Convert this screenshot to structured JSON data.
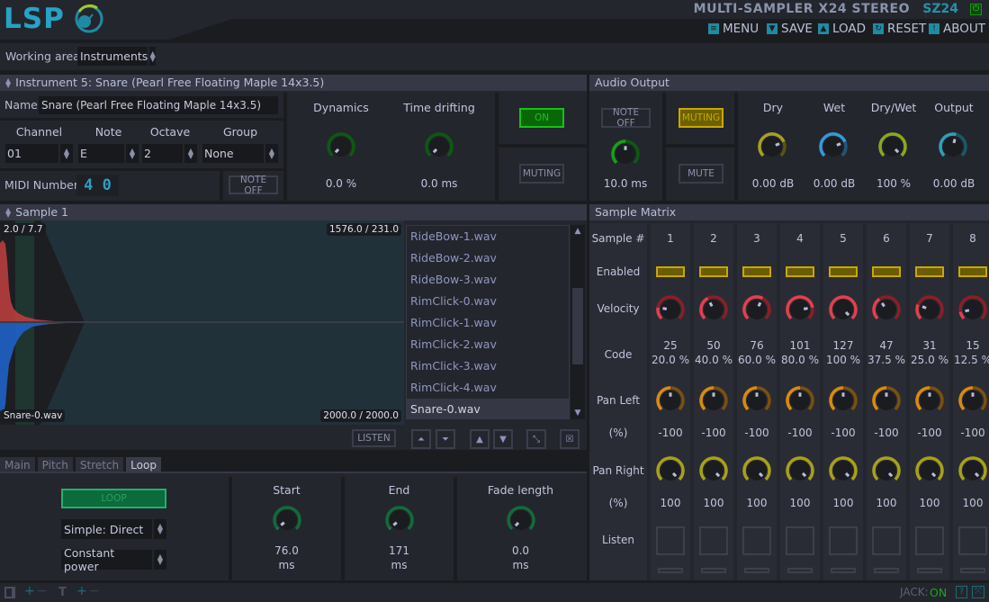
{
  "header": {
    "logo": "LSP",
    "plugin_title": "MULTI-SAMPLER X24 STEREO",
    "plugin_id": "SZ24",
    "menu": [
      {
        "label": "MENU",
        "icon": "menu-icon"
      },
      {
        "label": "SAVE",
        "icon": "save-icon"
      },
      {
        "label": "LOAD",
        "icon": "load-icon"
      },
      {
        "label": "RESET",
        "icon": "reset-icon"
      },
      {
        "label": "ABOUT",
        "icon": "about-icon"
      }
    ]
  },
  "working_area": {
    "label": "Working area",
    "value": "Instruments"
  },
  "instrument": {
    "title": "Instrument 5: Snare (Pearl Free Floating Maple 14x3.5)",
    "name_label": "Name",
    "name_value": "Snare (Pearl Free Floating Maple 14x3.5)",
    "fields": [
      {
        "label": "Channel",
        "value": "01"
      },
      {
        "label": "Note",
        "value": "E"
      },
      {
        "label": "Octave",
        "value": "2"
      },
      {
        "label": "Group",
        "value": "None"
      }
    ],
    "midi_label": "MIDI Number",
    "midi_value": "4 0",
    "note_off_label": "NOTE OFF",
    "dynamics": {
      "label": "Dynamics",
      "value": "0.0 %",
      "fraction": 0.0
    },
    "time_drifting": {
      "label": "Time drifting",
      "value": "0.0 ms",
      "fraction": 0.0
    },
    "on_label": "ON",
    "muting_label": "MUTING"
  },
  "audio_output": {
    "title": "Audio Output",
    "note_off_label": "NOTE OFF",
    "note_off_time": {
      "value": "10.0 ms",
      "fraction": 0.5
    },
    "muting_label": "MUTING",
    "mute_label": "MUTE",
    "knobs": [
      {
        "label": "Dry",
        "value": "0.00 dB",
        "fraction": 0.75,
        "color": "#a8a020"
      },
      {
        "label": "Wet",
        "value": "0.00 dB",
        "fraction": 0.75,
        "color": "#3898d8"
      },
      {
        "label": "Dry/Wet",
        "value": "100 %",
        "fraction": 1.0,
        "color": "#88a820"
      },
      {
        "label": "Output",
        "value": "0.00 dB",
        "fraction": 0.55,
        "color": "#30a0b8"
      }
    ]
  },
  "sample": {
    "title": "Sample 1",
    "top_left": "2.0 / 7.7",
    "top_right": "1576.0 / 231.0",
    "bottom_left": "Snare-0.wav",
    "bottom_right": "2000.0 / 2000.0",
    "listen_label": "LISTEN",
    "files": [
      "RideBow-1.wav",
      "RideBow-2.wav",
      "RideBow-3.wav",
      "RimClick-0.wav",
      "RimClick-1.wav",
      "RimClick-2.wav",
      "RimClick-3.wav",
      "RimClick-4.wav",
      "Snare-0.wav"
    ],
    "selected_file": "Snare-0.wav"
  },
  "tabs": [
    "Main",
    "Pitch",
    "Stretch",
    "Loop"
  ],
  "active_tab": "Loop",
  "loop": {
    "loop_label": "LOOP",
    "mode": "Simple: Direct",
    "crossfade": "Constant power",
    "knobs": [
      {
        "label": "Start",
        "value": "76.0",
        "unit": "ms",
        "fraction": 0.02
      },
      {
        "label": "End",
        "value": "171",
        "unit": "ms",
        "fraction": 0.02
      },
      {
        "label": "Fade length",
        "value": "0.0",
        "unit": "ms",
        "fraction": 0.0
      }
    ]
  },
  "matrix": {
    "title": "Sample Matrix",
    "row_labels": {
      "sample": "Sample #",
      "enabled": "Enabled",
      "velocity": "Velocity",
      "code": "Code",
      "pan_left": "Pan Left",
      "pan_left_unit": "(%)",
      "pan_right": "Pan Right",
      "pan_right_unit": "(%)",
      "listen": "Listen"
    },
    "columns": [
      {
        "n": "1",
        "code": "25",
        "pct": "20.0 %",
        "vel": 0.2,
        "pl": "-100",
        "pr": "100"
      },
      {
        "n": "2",
        "code": "50",
        "pct": "40.0 %",
        "vel": 0.4,
        "pl": "-100",
        "pr": "100"
      },
      {
        "n": "3",
        "code": "76",
        "pct": "60.0 %",
        "vel": 0.6,
        "pl": "-100",
        "pr": "100"
      },
      {
        "n": "4",
        "code": "101",
        "pct": "80.0 %",
        "vel": 0.8,
        "pl": "-100",
        "pr": "100"
      },
      {
        "n": "5",
        "code": "127",
        "pct": "100 %",
        "vel": 1.0,
        "pl": "-100",
        "pr": "100"
      },
      {
        "n": "6",
        "code": "47",
        "pct": "37.5 %",
        "vel": 0.375,
        "pl": "-100",
        "pr": "100"
      },
      {
        "n": "7",
        "code": "31",
        "pct": "25.0 %",
        "vel": 0.25,
        "pl": "-100",
        "pr": "100"
      },
      {
        "n": "8",
        "code": "15",
        "pct": "12.5 %",
        "vel": 0.125,
        "pl": "-100",
        "pr": "100"
      }
    ]
  },
  "status": {
    "jack_label": "JACK:",
    "jack_value": "ON"
  },
  "colors": {
    "accent": "#26a3c4",
    "on_green": "#1eb41e",
    "muting_yellow": "#c8b000",
    "velocity_red": "#e04050",
    "pan_left_orange": "#d88a10",
    "pan_right_yellow": "#b0a820"
  }
}
